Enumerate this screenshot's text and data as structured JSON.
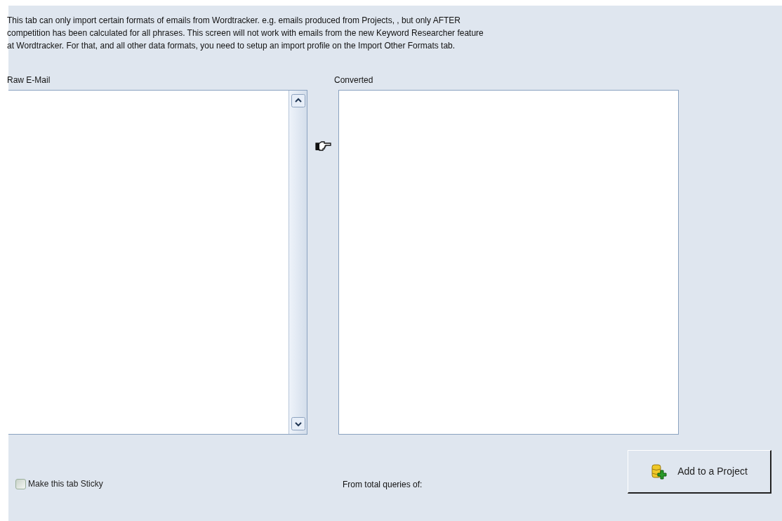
{
  "intro_lines": [
    "This tab can only import certain formats of emails from Wordtracker.  e.g. emails produced from Projects, , but only AFTER",
    "competition has been calculated for all phrases.  This screen will not work with emails from the new Keyword Researcher feature",
    "at Wordtracker.  For that, and all other data formats, you need to setup an import profile on the Import Other Formats tab."
  ],
  "raw_email": {
    "label": "Raw E-Mail"
  },
  "converted": {
    "label": "Converted"
  },
  "sticky_checkbox": {
    "label": "Make this tab Sticky",
    "checked": false
  },
  "total_queries": {
    "label": "From total queries of:"
  },
  "add_button": {
    "label": "Add to a Project"
  }
}
